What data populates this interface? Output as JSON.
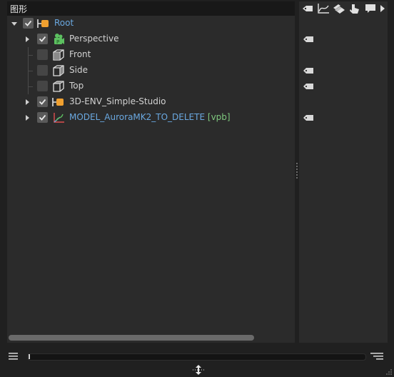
{
  "panel": {
    "title": "图形"
  },
  "toolbar": {
    "buttons": [
      "tag-icon",
      "curve-icon",
      "layers-icon",
      "pointer-icon",
      "comment-icon",
      "more-arrow-icon"
    ]
  },
  "tree": [
    {
      "name": "Root",
      "level": 0,
      "expanded": true,
      "checked": true,
      "icon": "null-group-icon",
      "blue": true,
      "tag": "",
      "has_tag": false
    },
    {
      "name": "Perspective",
      "level": 1,
      "expanded": false,
      "has_children": true,
      "checked": true,
      "icon": "perspective-camera-icon",
      "has_tag": true
    },
    {
      "name": "Front",
      "level": 1,
      "has_children": false,
      "checked": false,
      "icon": "cube-view-icon",
      "has_tag": false
    },
    {
      "name": "Side",
      "level": 1,
      "has_children": false,
      "checked": false,
      "icon": "cube-view-icon",
      "has_tag": true
    },
    {
      "name": "Top",
      "level": 1,
      "has_children": false,
      "checked": false,
      "icon": "cube-view-icon",
      "has_tag": true
    },
    {
      "name": "3D-ENV_Simple-Studio",
      "level": 1,
      "expanded": false,
      "has_children": true,
      "checked": true,
      "icon": "null-group-icon",
      "has_tag": false
    },
    {
      "name": "MODEL_AuroraMK2_TO_DELETE",
      "suffix": "[vpb]",
      "level": 1,
      "expanded": false,
      "has_children": true,
      "checked": true,
      "icon": "model-axis-icon",
      "blue": true,
      "has_tag": true
    }
  ],
  "colors": {
    "accent_orange": "#f0a030",
    "accent_blue": "#6aa8e0",
    "tag_green": "#7fc97f",
    "camera_green": "#5cc060"
  }
}
